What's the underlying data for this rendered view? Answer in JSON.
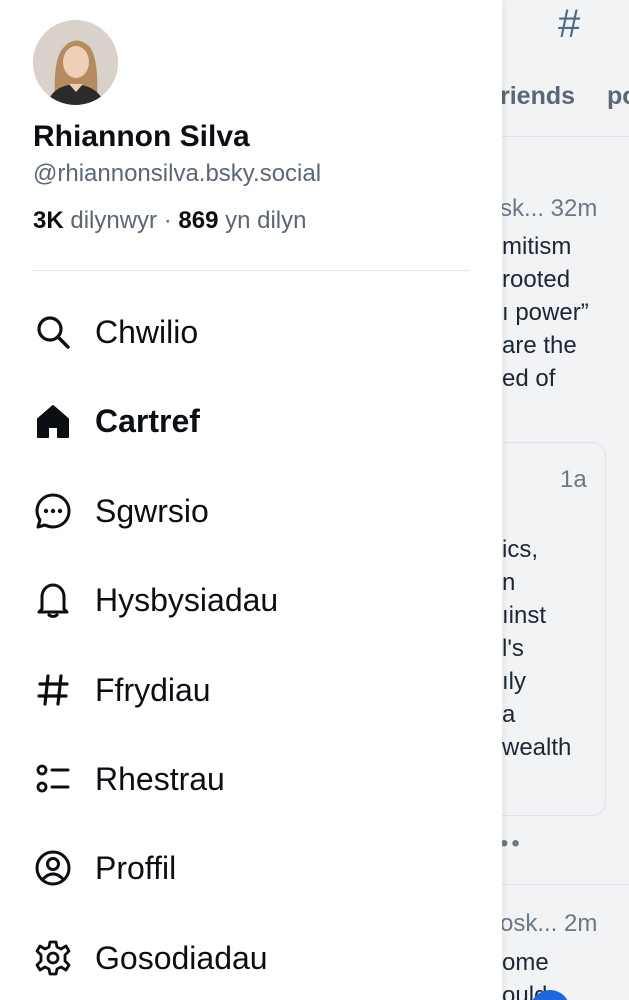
{
  "background": {
    "tabs": [
      "riends",
      "po"
    ],
    "posts": [
      {
        "meta": "sk... 32m",
        "lines": [
          "mitism",
          " rooted",
          "ı power”",
          "are the",
          "ed of"
        ]
      },
      {
        "meta": "1a",
        "lines": [
          "ics,",
          "n",
          "ıinst",
          "l's",
          "ıly",
          " a",
          "wealth"
        ]
      },
      {
        "meta": "osk... 2m",
        "lines": [
          "ome",
          "ould"
        ]
      }
    ],
    "dots": "••"
  },
  "profile": {
    "name": "Rhiannon Silva",
    "handle": "@rhiannonsilva.bsky.social",
    "followers_count": "3K",
    "followers_label": "dilynwyr",
    "separator": "·",
    "following_count": "869",
    "following_label": "yn dilyn"
  },
  "nav": [
    {
      "label": "Chwilio",
      "icon": "search-icon",
      "active": false
    },
    {
      "label": "Cartref",
      "icon": "home-icon",
      "active": true
    },
    {
      "label": "Sgwrsio",
      "icon": "chat-icon",
      "active": false
    },
    {
      "label": "Hysbysiadau",
      "icon": "bell-icon",
      "active": false
    },
    {
      "label": "Ffrydiau",
      "icon": "hashtag-icon",
      "active": false
    },
    {
      "label": "Rhestrau",
      "icon": "list-icon",
      "active": false
    },
    {
      "label": "Proffil",
      "icon": "profile-icon",
      "active": false
    },
    {
      "label": "Gosodiadau",
      "icon": "gear-icon",
      "active": false
    }
  ],
  "colors": {
    "text": "#0b0f14",
    "muted": "#5b6776",
    "accent": "#1d66e0"
  }
}
